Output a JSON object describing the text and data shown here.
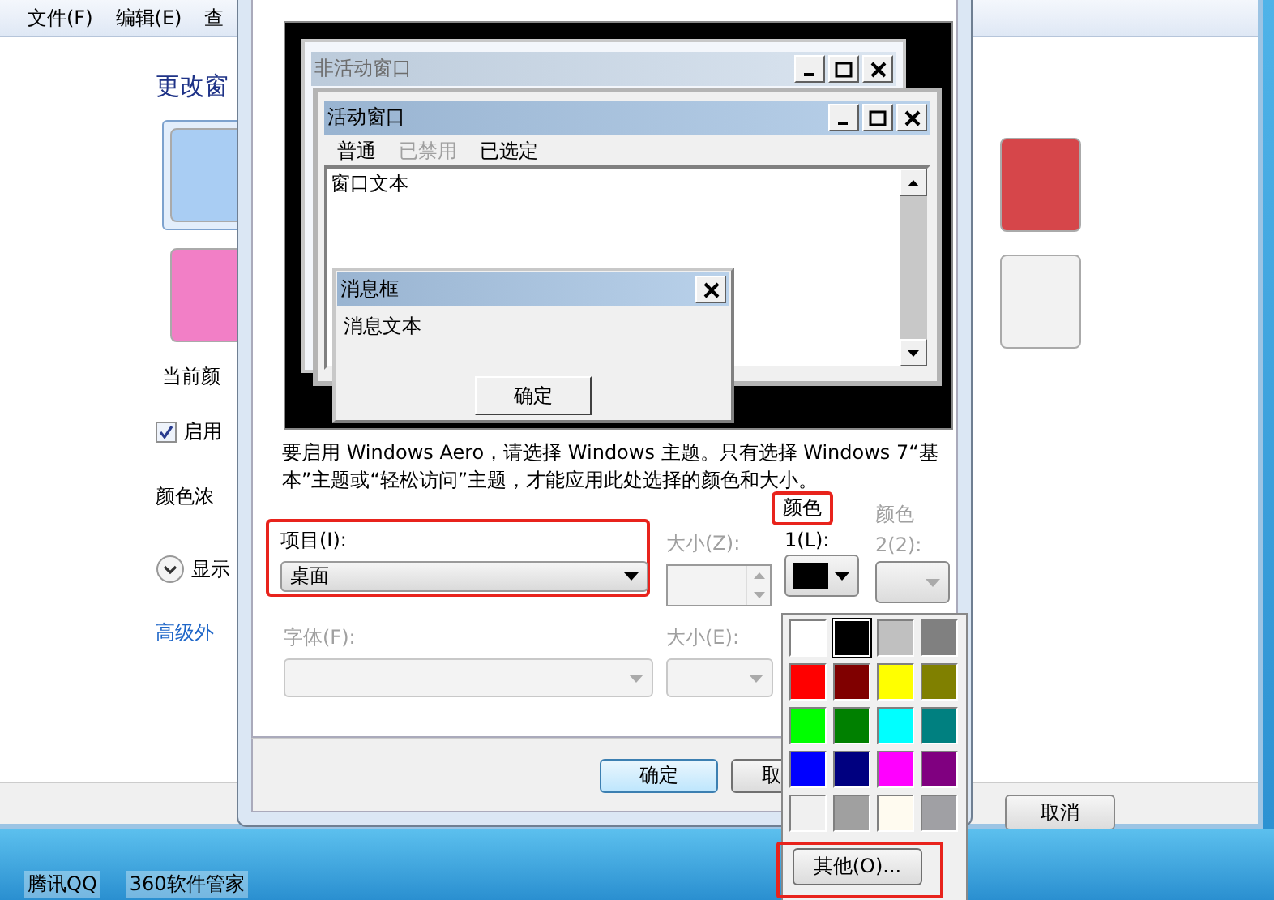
{
  "background_window": {
    "menu": [
      {
        "label": "文件(F)"
      },
      {
        "label": "编辑(E)"
      },
      {
        "label": "查"
      }
    ],
    "heading": "更改窗",
    "scheme_tiles": [
      {
        "color": "#a9cdf3",
        "selected": true
      },
      {
        "color": "#f27fc6",
        "selected": false
      },
      {
        "color": "#d6464a",
        "selected": false
      },
      {
        "color": "#f2f2f2",
        "selected": false
      }
    ],
    "current_color_label": "当前颜",
    "transparency": {
      "label": "启用",
      "checked": true
    },
    "intensity_label": "颜色浓",
    "show_mixer": "显示",
    "advanced_link": "高级外",
    "cancel_button": "取消"
  },
  "dialog": {
    "preview": {
      "inactive_title": "非活动窗口",
      "active_title": "活动窗口",
      "menu": [
        {
          "label": "普通",
          "disabled": false
        },
        {
          "label": "已禁用",
          "disabled": true
        },
        {
          "label": "已选定",
          "disabled": false
        }
      ],
      "window_text": "窗口文本",
      "message_title": "消息框",
      "message_text": "消息文本",
      "message_button": "确定"
    },
    "note": "要启用 Windows Aero，请选择 Windows 主题。只有选择 Windows 7“基本”主题或“轻松访问”主题，才能应用此处选择的颜色和大小。",
    "item": {
      "label": "项目(I):",
      "value": "桌面",
      "highlighted": true
    },
    "item_size": {
      "label": "大小(Z):",
      "disabled": true
    },
    "color1": {
      "heading": "颜色",
      "label": "1(L):",
      "color": "#000000",
      "heading_highlighted": true,
      "disabled": false
    },
    "color2": {
      "heading": "颜色",
      "label": "2(2):",
      "disabled": true
    },
    "font": {
      "label": "字体(F):",
      "disabled": true
    },
    "font_size": {
      "label": "大小(E):",
      "disabled": true
    },
    "ok_button": "确定",
    "cancel_button": "取"
  },
  "color_popup": {
    "swatches": [
      {
        "color": "#ffffff",
        "selected": false
      },
      {
        "color": "#000000",
        "selected": true
      },
      {
        "color": "#c0c0c0",
        "selected": false
      },
      {
        "color": "#808080",
        "selected": false
      },
      {
        "color": "#ff0000",
        "selected": false
      },
      {
        "color": "#800000",
        "selected": false
      },
      {
        "color": "#ffff00",
        "selected": false
      },
      {
        "color": "#808000",
        "selected": false
      },
      {
        "color": "#00ff00",
        "selected": false
      },
      {
        "color": "#008000",
        "selected": false
      },
      {
        "color": "#00ffff",
        "selected": false
      },
      {
        "color": "#008080",
        "selected": false
      },
      {
        "color": "#0000ff",
        "selected": false
      },
      {
        "color": "#000080",
        "selected": false
      },
      {
        "color": "#ff00ff",
        "selected": false
      },
      {
        "color": "#800080",
        "selected": false
      },
      {
        "color": "#f0f0f0",
        "selected": false
      },
      {
        "color": "#a0a0a0",
        "selected": false
      },
      {
        "color": "#fffbf0",
        "selected": false
      },
      {
        "color": "#a0a0a4",
        "selected": false
      }
    ],
    "other_button": {
      "label": "其他(O)...",
      "highlighted": true
    }
  },
  "taskbar": {
    "items": [
      {
        "label": "腾讯QQ"
      },
      {
        "label": "360软件管家"
      }
    ]
  }
}
